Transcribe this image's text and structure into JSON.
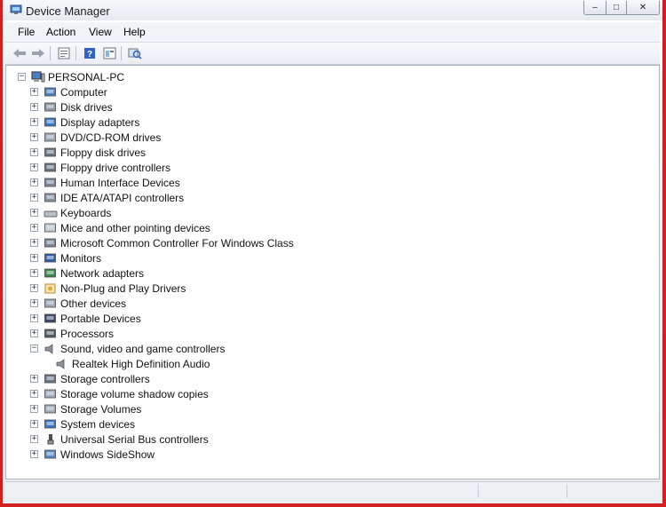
{
  "window": {
    "title": "Device Manager",
    "controls": [
      "–",
      "□",
      "✕"
    ]
  },
  "menu": [
    "File",
    "Action",
    "View",
    "Help"
  ],
  "toolbar": [
    {
      "name": "back-arrow-icon"
    },
    {
      "name": "forward-arrow-icon"
    },
    {
      "name": "properties-icon"
    },
    {
      "name": "help-icon"
    },
    {
      "name": "view-icon"
    },
    {
      "name": "scan-hardware-icon"
    }
  ],
  "tree": {
    "root": "PERSONAL-PC",
    "items": [
      {
        "label": "Computer",
        "icon": "computer-icon"
      },
      {
        "label": "Disk drives",
        "icon": "disk-drive-icon"
      },
      {
        "label": "Display adapters",
        "icon": "display-adapter-icon"
      },
      {
        "label": "DVD/CD-ROM drives",
        "icon": "dvd-drive-icon"
      },
      {
        "label": "Floppy disk drives",
        "icon": "floppy-drive-icon"
      },
      {
        "label": "Floppy drive controllers",
        "icon": "floppy-controller-icon"
      },
      {
        "label": "Human Interface Devices",
        "icon": "hid-icon"
      },
      {
        "label": "IDE ATA/ATAPI controllers",
        "icon": "ide-controller-icon"
      },
      {
        "label": "Keyboards",
        "icon": "keyboard-icon"
      },
      {
        "label": "Mice and other pointing devices",
        "icon": "mouse-icon"
      },
      {
        "label": "Microsoft Common Controller For Windows Class",
        "icon": "controller-icon"
      },
      {
        "label": "Monitors",
        "icon": "monitor-icon"
      },
      {
        "label": "Network adapters",
        "icon": "network-adapter-icon"
      },
      {
        "label": "Non-Plug and Play Drivers",
        "icon": "driver-icon"
      },
      {
        "label": "Other devices",
        "icon": "other-devices-icon"
      },
      {
        "label": "Portable Devices",
        "icon": "portable-device-icon"
      },
      {
        "label": "Processors",
        "icon": "processor-icon"
      },
      {
        "label": "Sound, video and game controllers",
        "icon": "speaker-icon",
        "expanded": true
      },
      {
        "label": "Realtek High Definition Audio",
        "icon": "speaker-icon",
        "child": true
      },
      {
        "label": "Storage controllers",
        "icon": "storage-controller-icon"
      },
      {
        "label": "Storage volume shadow copies",
        "icon": "storage-volume-icon"
      },
      {
        "label": "Storage Volumes",
        "icon": "storage-volume-icon"
      },
      {
        "label": "System devices",
        "icon": "system-device-icon"
      },
      {
        "label": "Universal Serial Bus controllers",
        "icon": "usb-icon"
      },
      {
        "label": "Windows SideShow",
        "icon": "sideshow-icon"
      }
    ]
  }
}
